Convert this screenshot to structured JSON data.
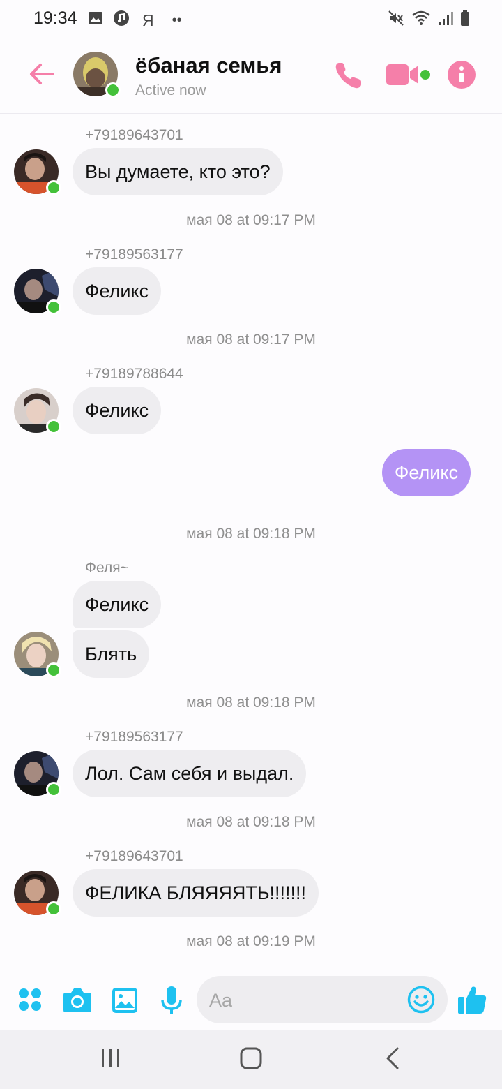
{
  "status_bar": {
    "time": "19:34",
    "extra_letter": "Я",
    "dots": "••"
  },
  "header": {
    "title": "ёбаная семья",
    "subtitle": "Active now",
    "accent_color": "#f57fa9",
    "online_color": "#44c13a"
  },
  "messages": [
    {
      "sender": "+79189643701",
      "text": "Вы думаете, кто это?"
    },
    {
      "timestamp": "мая 08 at 09:17 PM"
    },
    {
      "sender": "+79189563177",
      "text": "Феликс"
    },
    {
      "timestamp": "мая 08 at 09:17 PM"
    },
    {
      "sender": "+79189788644",
      "text": "Феликс"
    },
    {
      "outgoing": "Феликс"
    },
    {
      "timestamp": "мая 08 at 09:18 PM"
    },
    {
      "sender": "Феля~",
      "text_1": "Феликс",
      "text_2": "Блять"
    },
    {
      "timestamp": "мая 08 at 09:18 PM"
    },
    {
      "sender": "+79189563177",
      "text": "Лол. Сам себя и выдал."
    },
    {
      "timestamp": "мая 08 at 09:18 PM"
    },
    {
      "sender": "+79189643701",
      "text": "ФЕЛИКА БЛЯЯЯЯТЬ!!!!!!!"
    },
    {
      "timestamp": "мая 08 at 09:19 PM"
    }
  ],
  "composer": {
    "placeholder": "Aa",
    "icon_color": "#1ec1f0",
    "icons": [
      "apps-icon",
      "camera-icon",
      "image-icon",
      "mic-icon",
      "emoji-icon",
      "thumbs-up-icon"
    ]
  },
  "nav_bar": {
    "icons": [
      "recent-apps-icon",
      "home-icon",
      "back-nav-icon"
    ]
  }
}
